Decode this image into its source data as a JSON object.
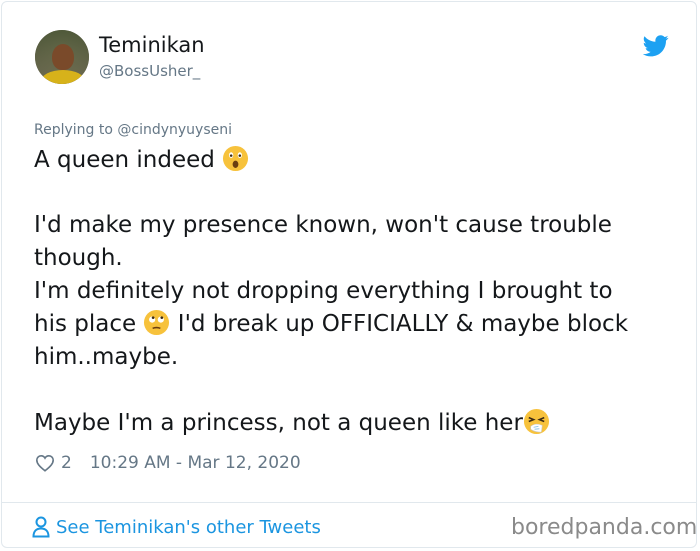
{
  "tweet": {
    "display_name": "Teminikan",
    "handle": "@BossUsher_",
    "replying_to": "Replying to @cindynyuyseni",
    "lines": [
      "A queen indeed",
      "I'd make my presence known, won't cause trouble",
      "though.",
      "I'm definitely not dropping everything I brought to",
      "his place",
      "I'd break up OFFICIALLY & maybe block",
      "him..maybe.",
      "Maybe I'm a princess, not a queen like her"
    ],
    "emojis": [
      "astonished-face",
      "face-with-rolling-eyes",
      "sneezing-face"
    ],
    "like_count": "2",
    "timestamp": "10:29 AM - Mar 12, 2020",
    "see_other_tweets": "See Teminikan's other Tweets"
  },
  "watermark": "boredpanda.com",
  "colors": {
    "twitter_blue": "#1da1f2",
    "link_blue": "#1b95e0",
    "secondary_gray": "#657786",
    "text": "#14171a"
  }
}
